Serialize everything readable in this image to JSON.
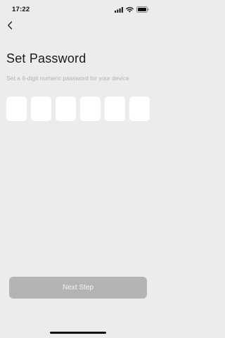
{
  "status_bar": {
    "time": "17:22",
    "icons": [
      "signal-icon",
      "wifi-icon",
      "battery-icon"
    ]
  },
  "nav": {
    "back_icon": "chevron-left-icon"
  },
  "page": {
    "title": "Set Password",
    "subtitle": "Set a 6-digit numeric password for your device",
    "pin_length": 6,
    "pin_values": [
      "",
      "",
      "",
      "",
      "",
      ""
    ]
  },
  "footer": {
    "next_label": "Next Step",
    "next_enabled": false
  },
  "colors": {
    "background": "#ececec",
    "pin_box": "#ffffff",
    "button_disabled": "#b4b4b4",
    "subtitle": "#b3b3b3"
  }
}
